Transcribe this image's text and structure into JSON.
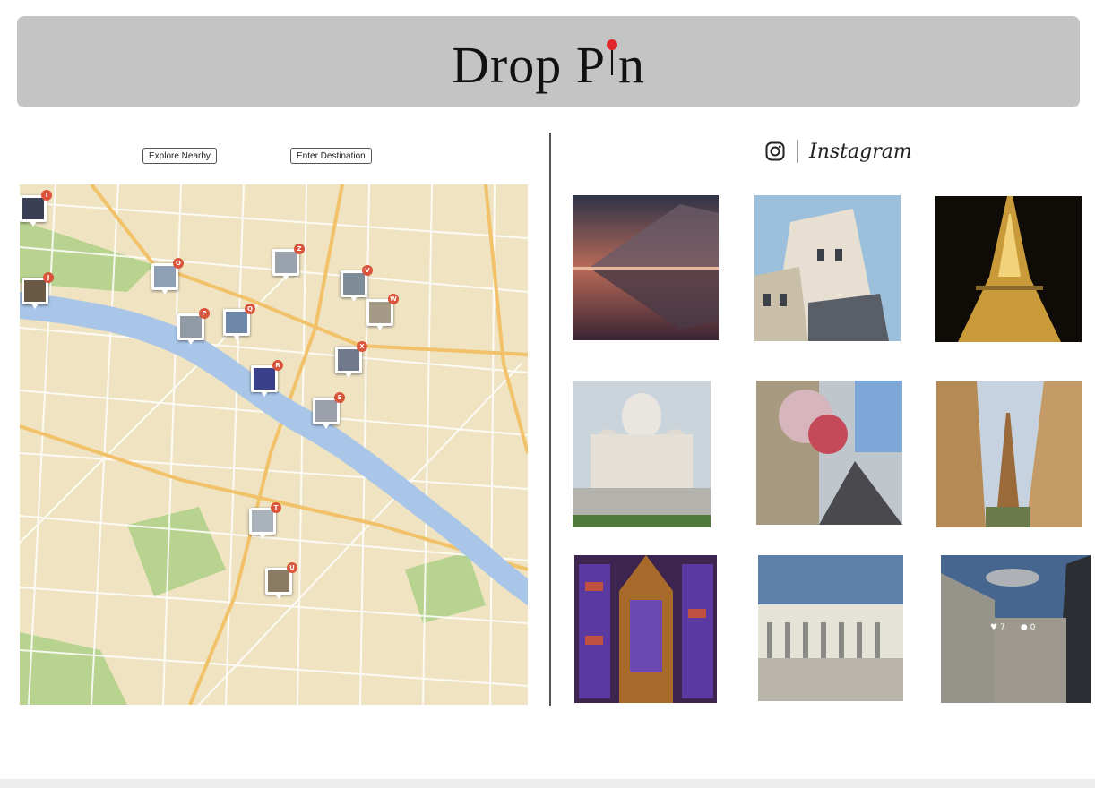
{
  "header": {
    "title_left": "Drop P",
    "title_right": "n"
  },
  "controls": {
    "explore_label": "Explore Nearby",
    "destination_label": "Enter Destination"
  },
  "map": {
    "markers": [
      {
        "letter": "I",
        "photo": "#3a3f55"
      },
      {
        "letter": "J",
        "photo": "#6a5a45"
      },
      {
        "letter": "O",
        "photo": "#8ea0b5"
      },
      {
        "letter": "Z",
        "photo": "#9aa3ad"
      },
      {
        "letter": "V",
        "photo": "#7e8c98"
      },
      {
        "letter": "W",
        "photo": "#a59a86"
      },
      {
        "letter": "P",
        "photo": "#8f9aa5"
      },
      {
        "letter": "Q",
        "photo": "#6f87a8"
      },
      {
        "letter": "X",
        "photo": "#707a8c"
      },
      {
        "letter": "R",
        "photo": "#3a3f8a"
      },
      {
        "letter": "S",
        "photo": "#9a9faa"
      },
      {
        "letter": "T",
        "photo": "#aab2bc"
      },
      {
        "letter": "U",
        "photo": "#8a7c63"
      }
    ]
  },
  "instagram": {
    "wordmark": "Instagram",
    "icon": "instagram-icon",
    "photos": [
      {
        "subject": "louvre-pyramid-dusk",
        "bg": "#4a2f3e"
      },
      {
        "subject": "parisian-building-facade",
        "bg": "#9cb6cc"
      },
      {
        "subject": "eiffel-tower-night",
        "bg": "#1a1408"
      },
      {
        "subject": "sacre-coeur",
        "bg": "#b8c0c8"
      },
      {
        "subject": "flower-street",
        "bg": "#8a8470"
      },
      {
        "subject": "eiffel-tower-street-view",
        "bg": "#b08a5c"
      },
      {
        "subject": "sainte-chapelle-stained-glass",
        "bg": "#5a2e3e"
      },
      {
        "subject": "palais-royal-colonnade",
        "bg": "#8fa6bf"
      },
      {
        "subject": "parisian-street-hover",
        "bg": "#6e7782"
      }
    ],
    "hover_stats": {
      "likes": "7",
      "comments": "0"
    }
  },
  "colors": {
    "header_bg": "#c4c4c4",
    "pin_red": "#e0252b",
    "marker_badge": "#d9543a",
    "river": "#a9c6e8"
  }
}
